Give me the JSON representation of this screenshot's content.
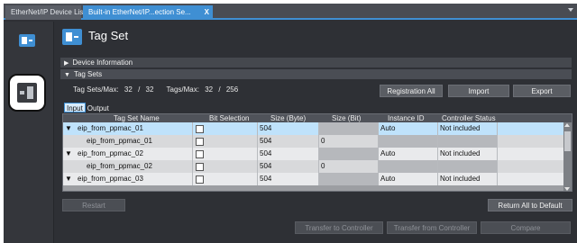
{
  "tabs": [
    {
      "label": "EtherNet/IP Device List"
    },
    {
      "label": "Built-in EtherNet/IP...ection Se...",
      "close": "X"
    }
  ],
  "page": {
    "title": "Tag Set"
  },
  "sections": {
    "device_information": "Device Information",
    "tag_sets": "Tag Sets"
  },
  "counts": {
    "tagsets_label": "Tag Sets/Max:",
    "tagsets_value": "32",
    "tagsets_sep": "/",
    "tagsets_max": "32",
    "tags_label": "Tags/Max:",
    "tags_value": "32",
    "tags_sep": "/",
    "tags_max": "256"
  },
  "buttons": {
    "registration_all": "Registration All",
    "import": "Import",
    "export": "Export",
    "restart": "Restart",
    "return_all_default": "Return All to Default",
    "transfer_to_controller": "Transfer to Controller",
    "transfer_from_controller": "Transfer from Controller",
    "compare": "Compare"
  },
  "subtabs": {
    "input": "Input",
    "output": "Output"
  },
  "table": {
    "headers": {
      "tag_set_name": "Tag Set Name",
      "bit_selection": "Bit Selection",
      "size_byte": "Size (Byte)",
      "size_bit": "Size (Bit)",
      "instance_id": "Instance ID",
      "controller_status": "Controller Status"
    },
    "rows": [
      {
        "expander": "▼",
        "name": "eip_from_ppmac_01",
        "size_byte": "504",
        "size_bit": "",
        "instance_id": "Auto",
        "controller_status": "Not included"
      },
      {
        "expander": "",
        "name": "eip_from_ppmac_01",
        "size_byte": "504",
        "size_bit": "0",
        "instance_id": "",
        "controller_status": ""
      },
      {
        "expander": "▼",
        "name": "eip_from_ppmac_02",
        "size_byte": "504",
        "size_bit": "",
        "instance_id": "Auto",
        "controller_status": "Not included"
      },
      {
        "expander": "",
        "name": "eip_from_ppmac_02",
        "size_byte": "504",
        "size_bit": "0",
        "instance_id": "",
        "controller_status": ""
      },
      {
        "expander": "▼",
        "name": "eip_from_ppmac_03",
        "size_byte": "504",
        "size_bit": "",
        "instance_id": "Auto",
        "controller_status": "Not included"
      }
    ]
  },
  "icons": {
    "rail_top": "device-list-icon",
    "rail_highlighted": "tag-set-icon",
    "header": "tag-set-header-icon"
  },
  "colors": {
    "accent": "#3f8fd3",
    "selected_row": "#bfe2fb",
    "background": "#2e3035"
  }
}
